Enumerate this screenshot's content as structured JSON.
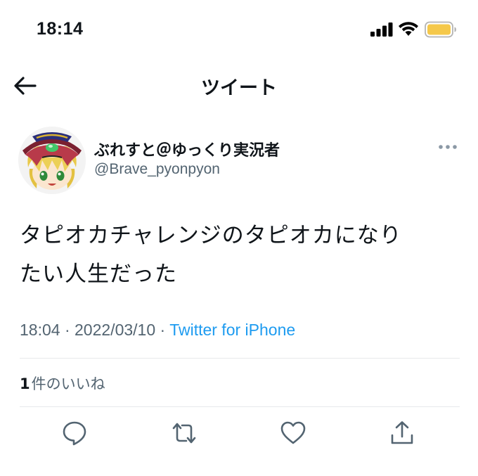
{
  "status_bar": {
    "time": "18:14"
  },
  "nav": {
    "title": "ツイート"
  },
  "author": {
    "display_name": "ぶれすと＠ゆっくり実況者",
    "handle": "@Brave_pyonpyon"
  },
  "tweet": {
    "text_line1": "タピオカチャレンジのタピオカになり",
    "text_line2": "たい人生だった",
    "time": "18:04",
    "separator": "·",
    "date": "2022/03/10",
    "source": "Twitter for iPhone"
  },
  "engagement": {
    "like_count": "1",
    "like_label": "件のいいね"
  },
  "actions": {
    "icons": [
      "reply-icon",
      "retweet-icon",
      "like-icon",
      "share-icon"
    ]
  },
  "colors": {
    "accent": "#1d9bf0",
    "secondary_text": "#536471",
    "battery": "#f5c84a"
  }
}
